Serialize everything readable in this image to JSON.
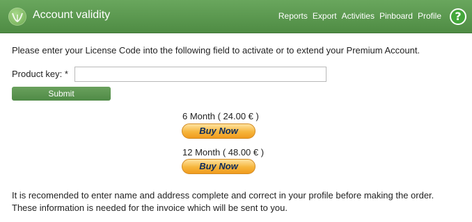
{
  "header": {
    "title": "Account validity",
    "nav": [
      "Reports",
      "Export",
      "Activities",
      "Pinboard",
      "Profile"
    ],
    "help_label": "?",
    "logo_icon": "leaf-logo-icon",
    "background": "#5a9a4f"
  },
  "main": {
    "intro": "Please enter your License Code into the following field to activate or to extend your Premium Account.",
    "product_key_label": "Product key: *",
    "product_key_value": "",
    "submit_label": "Submit",
    "offers": [
      {
        "label": "6 Month ( 24.00 € )",
        "button": "Buy Now"
      },
      {
        "label": "12 Month ( 48.00 € )",
        "button": "Buy Now"
      }
    ],
    "note": "It is recomended to enter name and address complete and correct in your profile before making the order. These information is needed for the invoice which will be sent to you."
  },
  "colors": {
    "accent_green": "#4f8c44",
    "buy_button_orange": "#f6b53c",
    "buy_text": "#0b2a5c"
  }
}
